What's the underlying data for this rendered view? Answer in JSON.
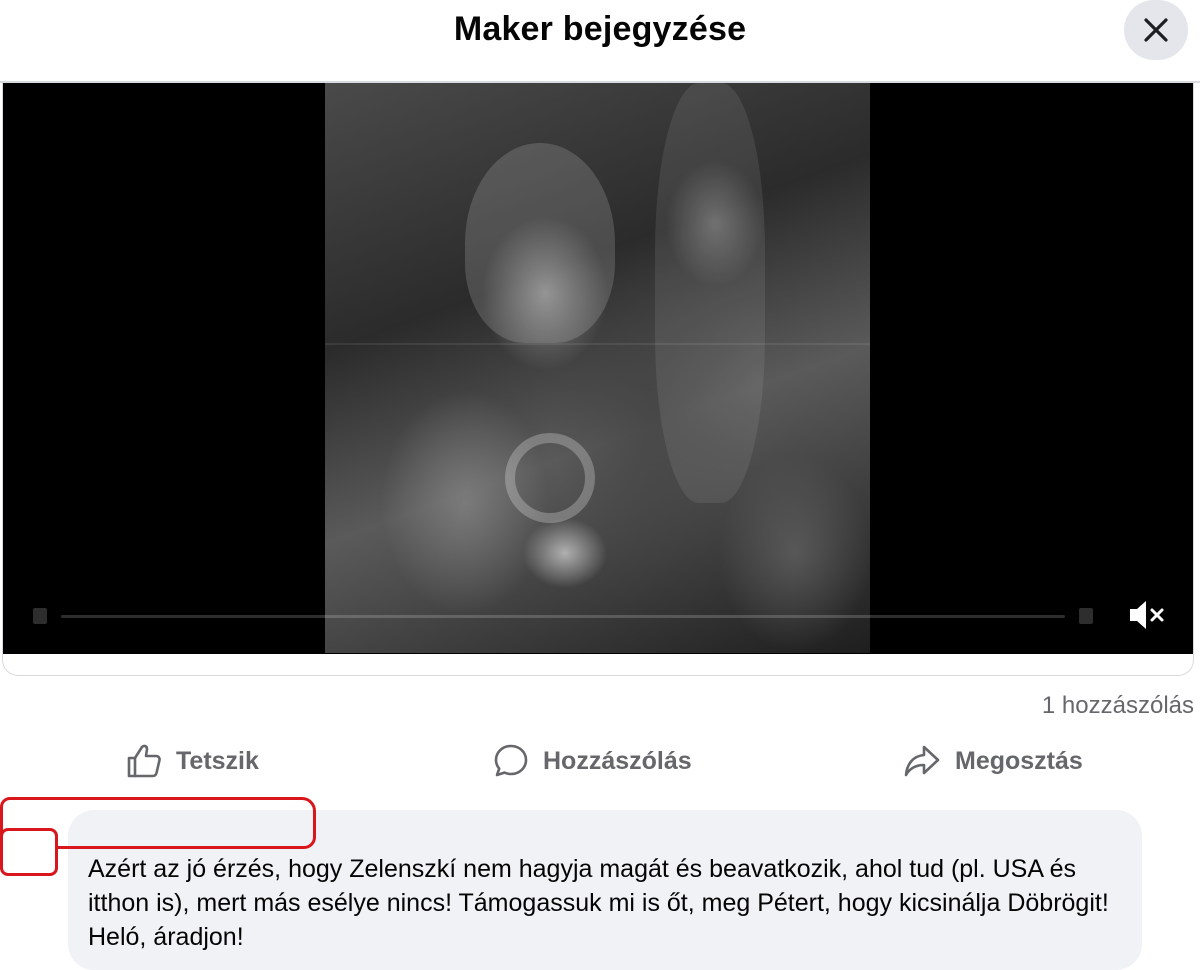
{
  "header": {
    "title": "Maker bejegyzése",
    "close_icon": "close-icon"
  },
  "video": {
    "mute_icon": "speaker-muted-icon"
  },
  "stats": {
    "comment_count": "1 hozzászólás"
  },
  "actions": {
    "like_label": "Tetszik",
    "like_icon": "thumbs-up-icon",
    "comment_label": "Hozzászólás",
    "comment_icon": "speech-bubble-icon",
    "share_label": "Megosztás",
    "share_icon": "share-arrow-icon"
  },
  "comment": {
    "text": "Azért az jó érzés, hogy Zelenszkí nem hagyja magát és beavatkozik, ahol tud (pl. USA és itthon is), mert más esélye nincs! Támogassuk mi is őt, meg Pétert, hogy kicsinálja Döbrögit! Heló, áradjon!"
  },
  "colors": {
    "accent_gray": "#65676b",
    "bubble_bg": "#f0f2f5",
    "redaction_red": "#d9161b"
  }
}
